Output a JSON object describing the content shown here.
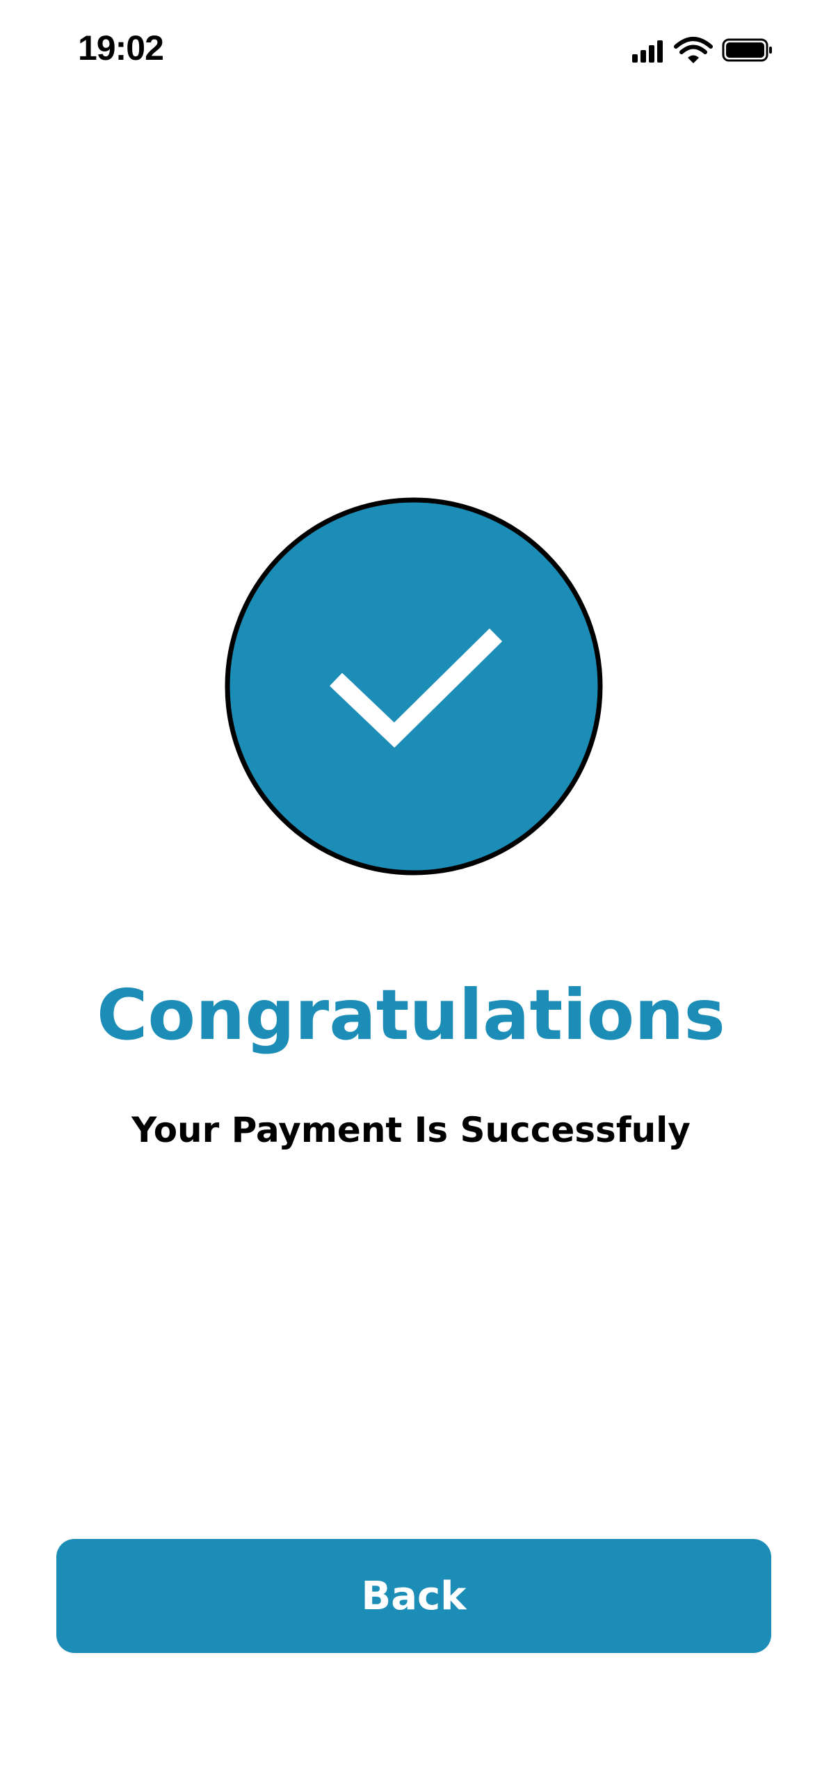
{
  "status_bar": {
    "time": "19:02",
    "icons": [
      "signal-icon",
      "wifi-icon",
      "battery-icon"
    ]
  },
  "success": {
    "icon": "checkmark-icon",
    "title": "Congratulations",
    "message": "Your Payment Is Successfuly"
  },
  "actions": {
    "back_label": "Back"
  },
  "colors": {
    "accent": "#1b8db6",
    "text": "#000000",
    "background": "#ffffff"
  }
}
